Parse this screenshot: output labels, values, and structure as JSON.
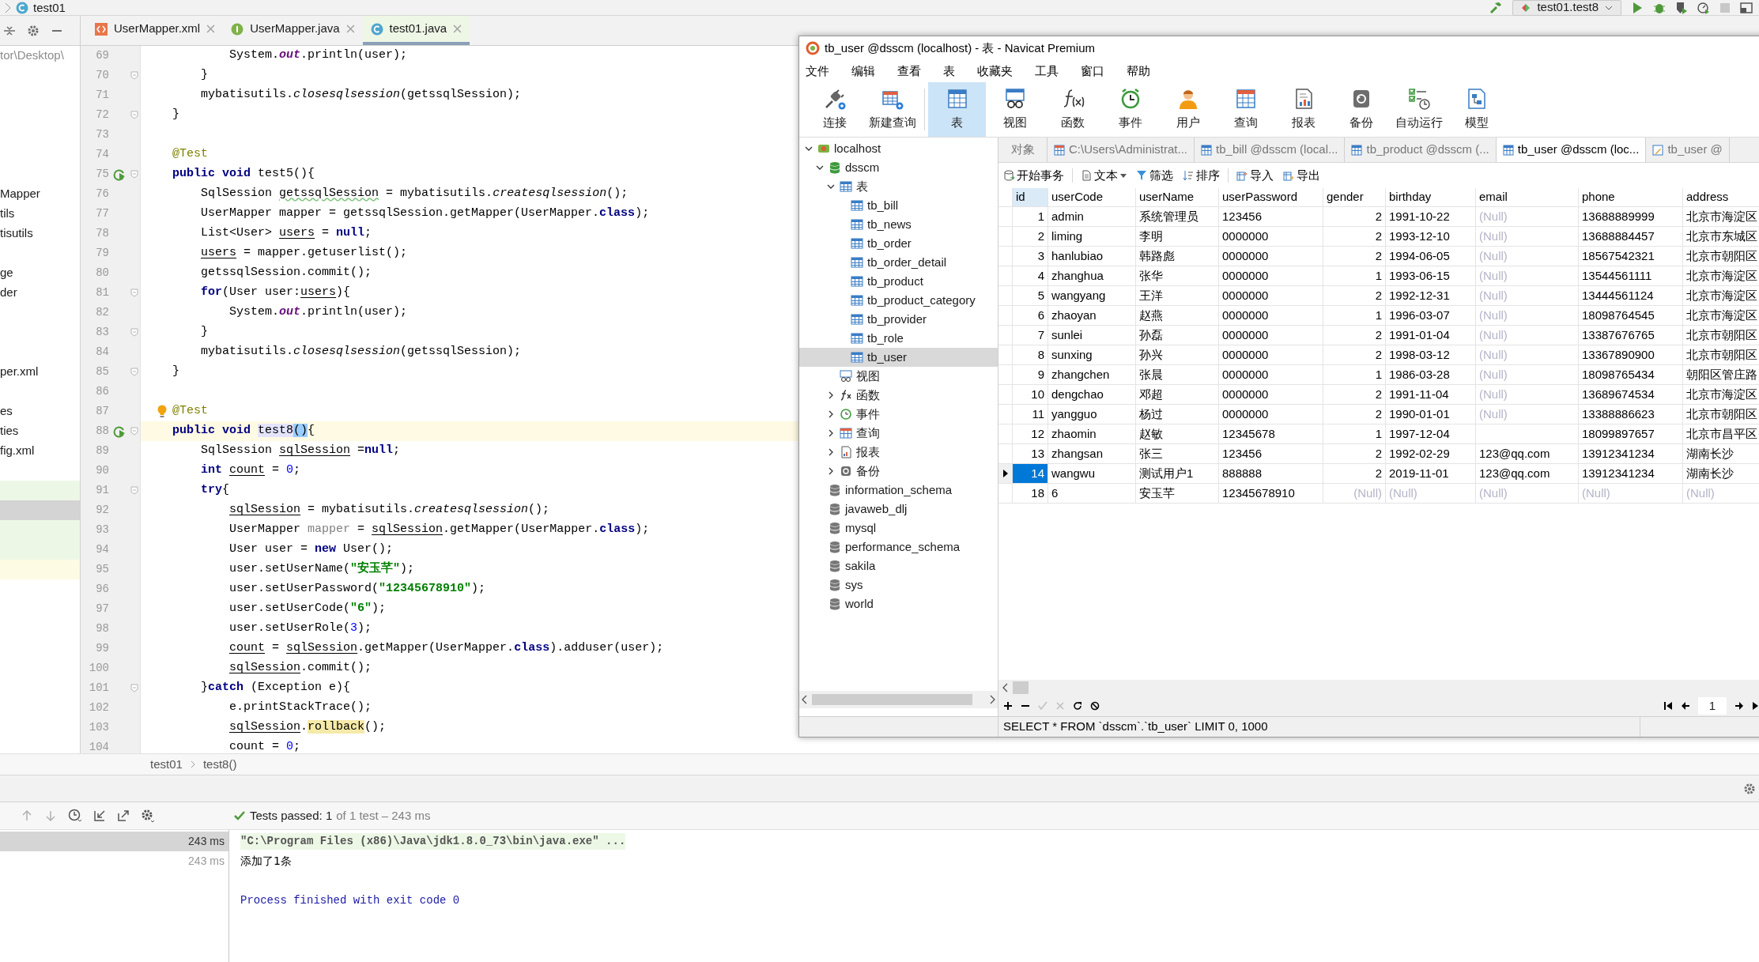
{
  "ide": {
    "breadcrumb_top": "test01",
    "run_config": "test01.test8",
    "tabs": [
      {
        "label": "UserMapper.xml",
        "kind": "xml",
        "selected": false
      },
      {
        "label": "UserMapper.java",
        "kind": "interface",
        "selected": false
      },
      {
        "label": "test01.java",
        "kind": "class",
        "selected": true
      }
    ],
    "project_items": [
      {
        "text": "tor\\Desktop\\",
        "kind": "path"
      },
      {
        "text": "Mapper",
        "kind": "file"
      },
      {
        "text": "tils",
        "kind": "file"
      },
      {
        "text": "tisutils",
        "kind": "file"
      },
      {
        "text": "ge",
        "kind": "file"
      },
      {
        "text": "der",
        "kind": "file"
      },
      {
        "text": "per.xml",
        "kind": "file"
      },
      {
        "text": "es",
        "kind": "file"
      },
      {
        "text": "ties",
        "kind": "file"
      },
      {
        "text": "fig.xml",
        "kind": "file"
      }
    ],
    "lines": [
      {
        "number": "69",
        "tokens": [
          {
            "kind": "plain",
            "text": "        System."
          },
          {
            "kind": "field",
            "text": "out"
          },
          {
            "kind": "plain",
            "text": ".println(user);"
          }
        ]
      },
      {
        "number": "70",
        "fold": true,
        "tokens": [
          {
            "kind": "plain",
            "text": "    }"
          }
        ]
      },
      {
        "number": "71",
        "tokens": [
          {
            "kind": "plain",
            "text": "    mybatisutils."
          },
          {
            "kind": "static",
            "text": "closesqlsession"
          },
          {
            "kind": "plain",
            "text": "(getssqlSession);"
          }
        ]
      },
      {
        "number": "72",
        "fold": true,
        "tokens": [
          {
            "kind": "plain",
            "text": "}"
          }
        ]
      },
      {
        "number": "73"
      },
      {
        "number": "74",
        "tokens": [
          {
            "kind": "ann",
            "text": "@Test"
          }
        ]
      },
      {
        "number": "75",
        "runnable": true,
        "fold": true,
        "tokens": [
          {
            "kind": "kw",
            "text": "public void"
          },
          {
            "kind": "plain",
            "text": " test5(){"
          }
        ]
      },
      {
        "number": "76",
        "tokens": [
          {
            "kind": "plain",
            "text": "    SqlSession "
          },
          {
            "kind": "typo",
            "text": "getssqlSession"
          },
          {
            "kind": "plain",
            "text": " = mybatisutils."
          },
          {
            "kind": "static",
            "text": "createsqlsession"
          },
          {
            "kind": "plain",
            "text": "();"
          }
        ]
      },
      {
        "number": "77",
        "tokens": [
          {
            "kind": "plain",
            "text": "    UserMapper mapper = getssqlSession.getMapper(UserMapper."
          },
          {
            "kind": "kw",
            "text": "class"
          },
          {
            "kind": "plain",
            "text": ");"
          }
        ]
      },
      {
        "number": "78",
        "tokens": [
          {
            "kind": "plain",
            "text": "    List<User> "
          },
          {
            "kind": "var",
            "text": "users"
          },
          {
            "kind": "plain",
            "text": " = "
          },
          {
            "kind": "kw",
            "text": "null"
          },
          {
            "kind": "plain",
            "text": ";"
          }
        ]
      },
      {
        "number": "79",
        "tokens": [
          {
            "kind": "var",
            "text": "    users"
          },
          {
            "kind": "plain",
            "text": " = mapper.getuserlist();"
          }
        ]
      },
      {
        "number": "80",
        "tokens": [
          {
            "kind": "plain",
            "text": "    getssqlSession.commit();"
          }
        ]
      },
      {
        "number": "81",
        "fold": true,
        "tokens": [
          {
            "kind": "kw",
            "text": "    for"
          },
          {
            "kind": "plain",
            "text": "(User user:"
          },
          {
            "kind": "var",
            "text": "users"
          },
          {
            "kind": "plain",
            "text": "){"
          }
        ]
      },
      {
        "number": "82",
        "tokens": [
          {
            "kind": "plain",
            "text": "        System."
          },
          {
            "kind": "field",
            "text": "out"
          },
          {
            "kind": "plain",
            "text": ".println(user);"
          }
        ]
      },
      {
        "number": "83",
        "fold": true,
        "tokens": [
          {
            "kind": "plain",
            "text": "    }"
          }
        ]
      },
      {
        "number": "84",
        "tokens": [
          {
            "kind": "plain",
            "text": "    mybatisutils."
          },
          {
            "kind": "static",
            "text": "closesqlsession"
          },
          {
            "kind": "plain",
            "text": "(getssqlSession);"
          }
        ]
      },
      {
        "number": "85",
        "fold": true,
        "tokens": [
          {
            "kind": "plain",
            "text": "}"
          }
        ]
      },
      {
        "number": "86"
      },
      {
        "number": "87",
        "hint": true,
        "tokens": [
          {
            "kind": "ann",
            "text": "@Test"
          }
        ]
      },
      {
        "number": "88",
        "runnable": true,
        "fold": true,
        "current": true,
        "tokens": [
          {
            "kind": "kw",
            "text": "public void"
          },
          {
            "kind": "ident",
            "text": " test8"
          },
          {
            "kind": "brace",
            "text": "()"
          },
          {
            "kind": "plain",
            "text": "{"
          }
        ]
      },
      {
        "number": "89",
        "tokens": [
          {
            "kind": "plain",
            "text": "    SqlSession "
          },
          {
            "kind": "var",
            "text": "sqlSession"
          },
          {
            "kind": "plain",
            "text": " ="
          },
          {
            "kind": "kw",
            "text": "null"
          },
          {
            "kind": "plain",
            "text": ";"
          }
        ]
      },
      {
        "number": "90",
        "tokens": [
          {
            "kind": "kw",
            "text": "    int"
          },
          {
            "kind": "var",
            "text": " count"
          },
          {
            "kind": "plain",
            "text": " = "
          },
          {
            "kind": "num",
            "text": "0"
          },
          {
            "kind": "plain",
            "text": ";"
          }
        ]
      },
      {
        "number": "91",
        "fold": true,
        "tokens": [
          {
            "kind": "kw",
            "text": "    try"
          },
          {
            "kind": "plain",
            "text": "{"
          }
        ]
      },
      {
        "number": "92",
        "tokens": [
          {
            "kind": "var",
            "text": "        sqlSession"
          },
          {
            "kind": "plain",
            "text": " = mybatisutils."
          },
          {
            "kind": "static",
            "text": "createsqlsession"
          },
          {
            "kind": "plain",
            "text": "();"
          }
        ]
      },
      {
        "number": "93",
        "tokens": [
          {
            "kind": "plain",
            "text": "        UserMapper "
          },
          {
            "kind": "muted",
            "text": "mapper"
          },
          {
            "kind": "plain",
            "text": " = "
          },
          {
            "kind": "var",
            "text": "sqlSession"
          },
          {
            "kind": "plain",
            "text": ".getMapper(UserMapper."
          },
          {
            "kind": "kw",
            "text": "class"
          },
          {
            "kind": "plain",
            "text": ");"
          }
        ]
      },
      {
        "number": "94",
        "tokens": [
          {
            "kind": "plain",
            "text": "        User user = "
          },
          {
            "kind": "kw",
            "text": "new"
          },
          {
            "kind": "plain",
            "text": " User();"
          }
        ]
      },
      {
        "number": "95",
        "tokens": [
          {
            "kind": "plain",
            "text": "        user.setUserName("
          },
          {
            "kind": "str",
            "text": "\"安玉芊\""
          },
          {
            "kind": "plain",
            "text": ");"
          }
        ]
      },
      {
        "number": "96",
        "tokens": [
          {
            "kind": "plain",
            "text": "        user.setUserPassword("
          },
          {
            "kind": "str",
            "text": "\"12345678910\""
          },
          {
            "kind": "plain",
            "text": ");"
          }
        ]
      },
      {
        "number": "97",
        "tokens": [
          {
            "kind": "plain",
            "text": "        user.setUserCode("
          },
          {
            "kind": "str",
            "text": "\"6\""
          },
          {
            "kind": "plain",
            "text": ");"
          }
        ]
      },
      {
        "number": "98",
        "tokens": [
          {
            "kind": "plain",
            "text": "        user.setUserRole("
          },
          {
            "kind": "num",
            "text": "3"
          },
          {
            "kind": "plain",
            "text": ");"
          }
        ]
      },
      {
        "number": "99",
        "tokens": [
          {
            "kind": "var",
            "text": "        count"
          },
          {
            "kind": "plain",
            "text": " = "
          },
          {
            "kind": "var",
            "text": "sqlSession"
          },
          {
            "kind": "plain",
            "text": ".getMapper(UserMapper."
          },
          {
            "kind": "kw",
            "text": "class"
          },
          {
            "kind": "plain",
            "text": ").adduser(user);"
          }
        ]
      },
      {
        "number": "100",
        "tokens": [
          {
            "kind": "var",
            "text": "        sqlSession"
          },
          {
            "kind": "plain",
            "text": ".commit();"
          }
        ]
      },
      {
        "number": "101",
        "fold": true,
        "tokens": [
          {
            "kind": "plain",
            "text": "    }"
          },
          {
            "kind": "kw",
            "text": "catch"
          },
          {
            "kind": "plain",
            "text": " (Exception e){"
          }
        ]
      },
      {
        "number": "102",
        "tokens": [
          {
            "kind": "plain",
            "text": "        e.printStackTrace();"
          }
        ]
      },
      {
        "number": "103",
        "tokens": [
          {
            "kind": "var",
            "text": "        sqlSession"
          },
          {
            "kind": "plain",
            "text": "."
          },
          {
            "kind": "hl",
            "text": "rollback"
          },
          {
            "kind": "plain",
            "text": "();"
          }
        ]
      },
      {
        "number": "104",
        "tokens": [
          {
            "kind": "plain",
            "text": "        count = "
          },
          {
            "kind": "num",
            "text": "0"
          },
          {
            "kind": "plain",
            "text": ";"
          }
        ]
      }
    ],
    "breadcrumb": [
      "test01",
      "test8()"
    ],
    "tests": {
      "status": "Tests passed: 1",
      "detail": "of 1 test – 243 ms",
      "results": [
        {
          "time": "243 ms",
          "selected": true
        },
        {
          "time": "243 ms",
          "selected": false
        }
      ],
      "console": [
        {
          "kind": "command",
          "text": "\"C:\\Program Files (x86)\\Java\\jdk1.8.0_73\\bin\\java.exe\" ..."
        },
        {
          "kind": "plain",
          "text": "添加了1条"
        },
        {
          "kind": "exit",
          "text": "Process finished with exit code 0"
        }
      ]
    }
  },
  "navicat": {
    "title": "tb_user @dsscm (localhost) - 表 - Navicat Premium",
    "menu": [
      "文件",
      "编辑",
      "查看",
      "表",
      "收藏夹",
      "工具",
      "窗口",
      "帮助"
    ],
    "toolbar": [
      {
        "label": "连接",
        "selected": false
      },
      {
        "label": "新建查询",
        "selected": false
      },
      {
        "label": "表",
        "selected": true
      },
      {
        "label": "视图",
        "selected": false
      },
      {
        "label": "函数",
        "selected": false
      },
      {
        "label": "事件",
        "selected": false
      },
      {
        "label": "用户",
        "selected": false
      },
      {
        "label": "查询",
        "selected": false
      },
      {
        "label": "报表",
        "selected": false
      },
      {
        "label": "备份",
        "selected": false
      },
      {
        "label": "自动运行",
        "selected": false
      },
      {
        "label": "模型",
        "selected": false
      }
    ],
    "tree": [
      {
        "label": "localhost",
        "kind": "server",
        "expanded": true,
        "selected": false,
        "children": [
          {
            "label": "dsscm",
            "kind": "database",
            "expanded": true,
            "selected": false,
            "children": [
              {
                "label": "表",
                "kind": "tables",
                "expanded": true,
                "selected": false,
                "children": [
                  {
                    "label": "tb_bill",
                    "kind": "table",
                    "selected": false
                  },
                  {
                    "label": "tb_news",
                    "kind": "table",
                    "selected": false
                  },
                  {
                    "label": "tb_order",
                    "kind": "table",
                    "selected": false
                  },
                  {
                    "label": "tb_order_detail",
                    "kind": "table",
                    "selected": false
                  },
                  {
                    "label": "tb_product",
                    "kind": "table",
                    "selected": false
                  },
                  {
                    "label": "tb_product_category",
                    "kind": "table",
                    "selected": false
                  },
                  {
                    "label": "tb_provider",
                    "kind": "table",
                    "selected": false
                  },
                  {
                    "label": "tb_role",
                    "kind": "table",
                    "selected": false
                  },
                  {
                    "label": "tb_user",
                    "kind": "table",
                    "selected": true
                  }
                ]
              },
              {
                "label": "视图",
                "kind": "views",
                "selected": false
              },
              {
                "label": "函数",
                "kind": "functions",
                "expanded": false,
                "selected": false
              },
              {
                "label": "事件",
                "kind": "events",
                "expanded": false,
                "selected": false
              },
              {
                "label": "查询",
                "kind": "queries",
                "expanded": false,
                "selected": false
              },
              {
                "label": "报表",
                "kind": "reports",
                "expanded": false,
                "selected": false
              },
              {
                "label": "备份",
                "kind": "backups",
                "expanded": false,
                "selected": false
              }
            ]
          },
          {
            "label": "information_schema",
            "kind": "database",
            "selected": false
          },
          {
            "label": "javaweb_dlj",
            "kind": "database",
            "selected": false
          },
          {
            "label": "mysql",
            "kind": "database",
            "selected": false
          },
          {
            "label": "performance_schema",
            "kind": "database",
            "selected": false
          },
          {
            "label": "sakila",
            "kind": "database",
            "selected": false
          },
          {
            "label": "sys",
            "kind": "database",
            "selected": false
          },
          {
            "label": "world",
            "kind": "database",
            "selected": false
          }
        ]
      }
    ],
    "tabs": [
      {
        "label": "对象",
        "kind": "objects",
        "selected": false
      },
      {
        "label": "C:\\Users\\Administrat...",
        "kind": "query",
        "selected": false
      },
      {
        "label": "tb_bill @dsscm (local...",
        "kind": "table",
        "selected": false
      },
      {
        "label": "tb_product @dsscm (...",
        "kind": "table",
        "selected": false
      },
      {
        "label": "tb_user @dsscm (loc...",
        "kind": "table",
        "selected": true
      },
      {
        "label": "tb_user @",
        "kind": "design",
        "selected": false
      }
    ],
    "actions": [
      "开始事务",
      "文本",
      "筛选",
      "排序",
      "导入",
      "导出"
    ],
    "table": {
      "columns": [
        "id",
        "userCode",
        "userName",
        "userPassword",
        "gender",
        "birthday",
        "email",
        "phone",
        "address"
      ],
      "rows": [
        {
          "selected": false,
          "cells": [
            "1",
            "admin",
            "系统管理员",
            "123456",
            "2",
            "1991-10-22",
            {
              "text": "(Null)",
              "null": true
            },
            "13688889999",
            "北京市海淀区"
          ]
        },
        {
          "selected": false,
          "cells": [
            "2",
            "liming",
            "李明",
            "0000000",
            "2",
            "1993-12-10",
            {
              "text": "(Null)",
              "null": true
            },
            "13688884457",
            "北京市东城区"
          ]
        },
        {
          "selected": false,
          "cells": [
            "3",
            "hanlubiao",
            "韩路彪",
            "0000000",
            "2",
            "1994-06-05",
            {
              "text": "(Null)",
              "null": true
            },
            "18567542321",
            "北京市朝阳区"
          ]
        },
        {
          "selected": false,
          "cells": [
            "4",
            "zhanghua",
            "张华",
            "0000000",
            "1",
            "1993-06-15",
            {
              "text": "(Null)",
              "null": true
            },
            "13544561111",
            "北京市海淀区"
          ]
        },
        {
          "selected": false,
          "cells": [
            "5",
            "wangyang",
            "王洋",
            "0000000",
            "2",
            "1992-12-31",
            {
              "text": "(Null)",
              "null": true
            },
            "13444561124",
            "北京市海淀区"
          ]
        },
        {
          "selected": false,
          "cells": [
            "6",
            "zhaoyan",
            "赵燕",
            "0000000",
            "1",
            "1996-03-07",
            {
              "text": "(Null)",
              "null": true
            },
            "18098764545",
            "北京市海淀区"
          ]
        },
        {
          "selected": false,
          "cells": [
            "7",
            "sunlei",
            "孙磊",
            "0000000",
            "2",
            "1991-01-04",
            {
              "text": "(Null)",
              "null": true
            },
            "13387676765",
            "北京市朝阳区"
          ]
        },
        {
          "selected": false,
          "cells": [
            "8",
            "sunxing",
            "孙兴",
            "0000000",
            "2",
            "1998-03-12",
            {
              "text": "(Null)",
              "null": true
            },
            "13367890900",
            "北京市朝阳区"
          ]
        },
        {
          "selected": false,
          "cells": [
            "9",
            "zhangchen",
            "张晨",
            "0000000",
            "1",
            "1986-03-28",
            {
              "text": "(Null)",
              "null": true
            },
            "18098765434",
            "朝阳区管庄路"
          ]
        },
        {
          "selected": false,
          "cells": [
            "10",
            "dengchao",
            "邓超",
            "0000000",
            "2",
            "1991-11-04",
            {
              "text": "(Null)",
              "null": true
            },
            "13689674534",
            "北京市海淀区"
          ]
        },
        {
          "selected": false,
          "cells": [
            "11",
            "yangguo",
            "杨过",
            "0000000",
            "2",
            "1990-01-01",
            {
              "text": "(Null)",
              "null": true
            },
            "13388886623",
            "北京市朝阳区"
          ]
        },
        {
          "selected": false,
          "cells": [
            "12",
            "zhaomin",
            "赵敏",
            "12345678",
            "1",
            "1997-12-04",
            null,
            "18099897657",
            "北京市昌平区"
          ]
        },
        {
          "selected": false,
          "cells": [
            "13",
            "zhangsan",
            "张三",
            "123456",
            "2",
            "1992-02-29",
            "123@qq.com",
            "13912341234",
            "湖南长沙"
          ]
        },
        {
          "selected": true,
          "cells": [
            "14",
            "wangwu",
            "测试用户1",
            "888888",
            "2",
            "2019-11-01",
            "123@qq.com",
            "13912341234",
            "湖南长沙"
          ]
        },
        {
          "selected": false,
          "cells": [
            "18",
            "6",
            "安玉芊",
            "12345678910",
            {
              "text": "(Null)",
              "null": true
            },
            {
              "text": "(Null)",
              "null": true
            },
            {
              "text": "(Null)",
              "null": true
            },
            {
              "text": "(Null)",
              "null": true
            },
            {
              "text": "(Null)",
              "null": true
            }
          ]
        }
      ]
    },
    "page": "1",
    "sql": "SELECT * FROM `dsscm`.`tb_user` LIMIT 0, 1000"
  }
}
